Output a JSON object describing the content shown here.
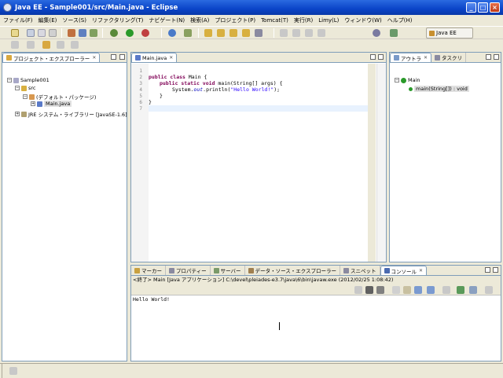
{
  "window": {
    "title": "Java EE - Sample001/src/Main.java - Eclipse"
  },
  "menu": [
    "ファイル(F)",
    "編集(E)",
    "ソース(S)",
    "リファクタリング(T)",
    "ナビゲート(N)",
    "検索(A)",
    "プロジェクト(P)",
    "Tomcat(T)",
    "実行(R)",
    "Limy(L)",
    "ウィンドウ(W)",
    "ヘルプ(H)"
  ],
  "perspective": {
    "label": "Java EE"
  },
  "explorer": {
    "tab": "プロジェクト・エクスプローラー",
    "items": [
      "Sample001",
      "src",
      "(デフォルト・パッケージ)",
      "Main.java",
      "JRE システム・ライブラリー [JavaSE-1.6]"
    ]
  },
  "editor": {
    "tab": "Main.java",
    "lines": [
      "1",
      "2",
      "3",
      "4",
      "5",
      "6",
      "7"
    ],
    "code": {
      "l2_kw": "public class",
      "l2_rest": " Main {",
      "l3_kw": "public static void",
      "l3_rest": " main(String[] args) {",
      "l4_pre": "System.",
      "l4_field": "out",
      "l4_mid": ".println(",
      "l4_str": "\"Hello World!\"",
      "l4_post": ");",
      "l5": "}",
      "l6": "}"
    }
  },
  "outline": {
    "tabs": [
      "アウトラ",
      "タスクリ"
    ],
    "items": [
      "Main",
      "main(String[]) : void"
    ]
  },
  "bottom": {
    "tabs": [
      "マーカー",
      "プロパティー",
      "サーバー",
      "データ・ソース・エクスプローラー",
      "スニペット",
      "コンソール"
    ],
    "console_header": "<終了> Main [Java アプリケーション] C:\\devel\\pleiades-e3.7\\java\\6\\bin\\javaw.exe (2012/02/25 1:08:42)",
    "console_output": "Hello World!"
  }
}
